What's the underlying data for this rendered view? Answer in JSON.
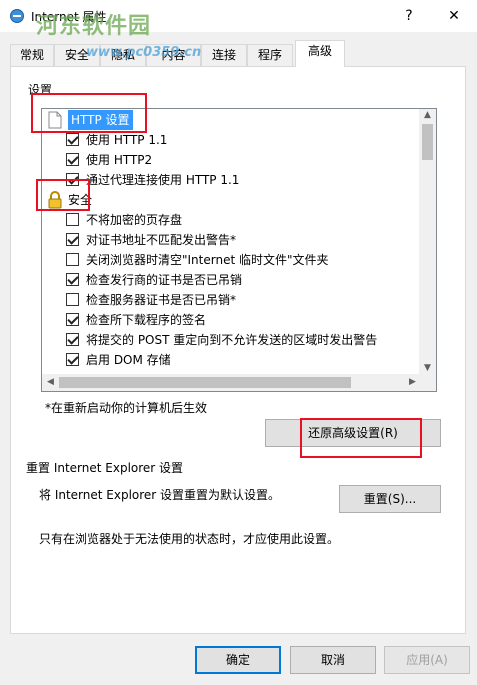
{
  "window": {
    "title": "Internet 属性",
    "help_glyph": "?",
    "close_glyph": "✕",
    "watermark": "河东软件园",
    "watermark_url": "www.pc0359.cn"
  },
  "tabs": [
    {
      "label": "常规"
    },
    {
      "label": "安全"
    },
    {
      "label": "隐私"
    },
    {
      "label": "内容"
    },
    {
      "label": "连接"
    },
    {
      "label": "程序"
    },
    {
      "label": "高级"
    }
  ],
  "settings": {
    "group_label": "设置",
    "categories": {
      "http": "HTTP 设置",
      "security": "安全"
    },
    "http_items": [
      {
        "label": "使用 HTTP 1.1",
        "checked": true
      },
      {
        "label": "使用 HTTP2",
        "checked": true
      },
      {
        "label": "通过代理连接使用 HTTP 1.1",
        "checked": true
      }
    ],
    "security_items": [
      {
        "label": "不将加密的页存盘",
        "checked": false
      },
      {
        "label": "对证书地址不匹配发出警告*",
        "checked": true
      },
      {
        "label": "关闭浏览器时清空\"Internet 临时文件\"文件夹",
        "checked": false
      },
      {
        "label": "检查发行商的证书是否已吊销",
        "checked": true
      },
      {
        "label": "检查服务器证书是否已吊销*",
        "checked": false
      },
      {
        "label": "检查所下载程序的签名",
        "checked": true
      },
      {
        "label": "将提交的 POST 重定向到不允许发送的区域时发出警告",
        "checked": true
      },
      {
        "label": "启用 DOM 存储",
        "checked": true
      }
    ],
    "restart_note": "*在重新启动你的计算机后生效",
    "restore_button": "还原高级设置(R)"
  },
  "reset": {
    "heading": "重置 Internet Explorer 设置",
    "description": "将 Internet Explorer 设置重置为默认设置。",
    "button": "重置(S)...",
    "note": "只有在浏览器处于无法使用的状态时，才应使用此设置。"
  },
  "footer": {
    "ok": "确定",
    "cancel": "取消",
    "apply": "应用(A)"
  },
  "colors": {
    "highlight_frame": "#e81123",
    "selection": "#3399ff",
    "default_button_border": "#0078d7"
  },
  "icons": {
    "http": "document-icon",
    "security": "padlock-icon"
  }
}
